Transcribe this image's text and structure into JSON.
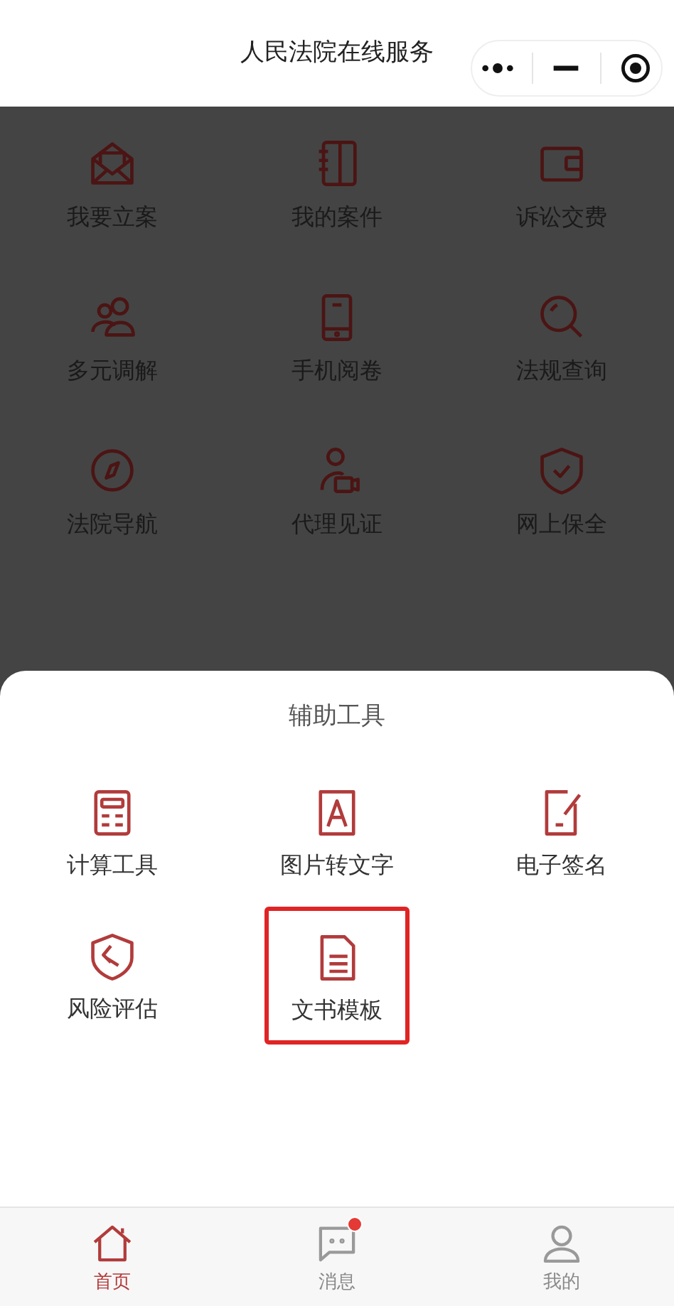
{
  "header": {
    "title": "人民法院在线服务"
  },
  "services": [
    {
      "label": "我要立案"
    },
    {
      "label": "我的案件"
    },
    {
      "label": "诉讼交费"
    },
    {
      "label": "多元调解"
    },
    {
      "label": "手机阅卷"
    },
    {
      "label": "法规查询"
    },
    {
      "label": "法院导航"
    },
    {
      "label": "代理见证"
    },
    {
      "label": "网上保全"
    }
  ],
  "tool_sheet": {
    "title": "辅助工具",
    "items": [
      {
        "label": "计算工具",
        "highlighted": false
      },
      {
        "label": "图片转文字",
        "highlighted": false
      },
      {
        "label": "电子签名",
        "highlighted": false
      },
      {
        "label": "风险评估",
        "highlighted": false
      },
      {
        "label": "文书模板",
        "highlighted": true
      }
    ]
  },
  "tab_bar": [
    {
      "label": "首页",
      "selected": true,
      "dot": false
    },
    {
      "label": "消息",
      "selected": false,
      "dot": true
    },
    {
      "label": "我的",
      "selected": false,
      "dot": false
    }
  ]
}
